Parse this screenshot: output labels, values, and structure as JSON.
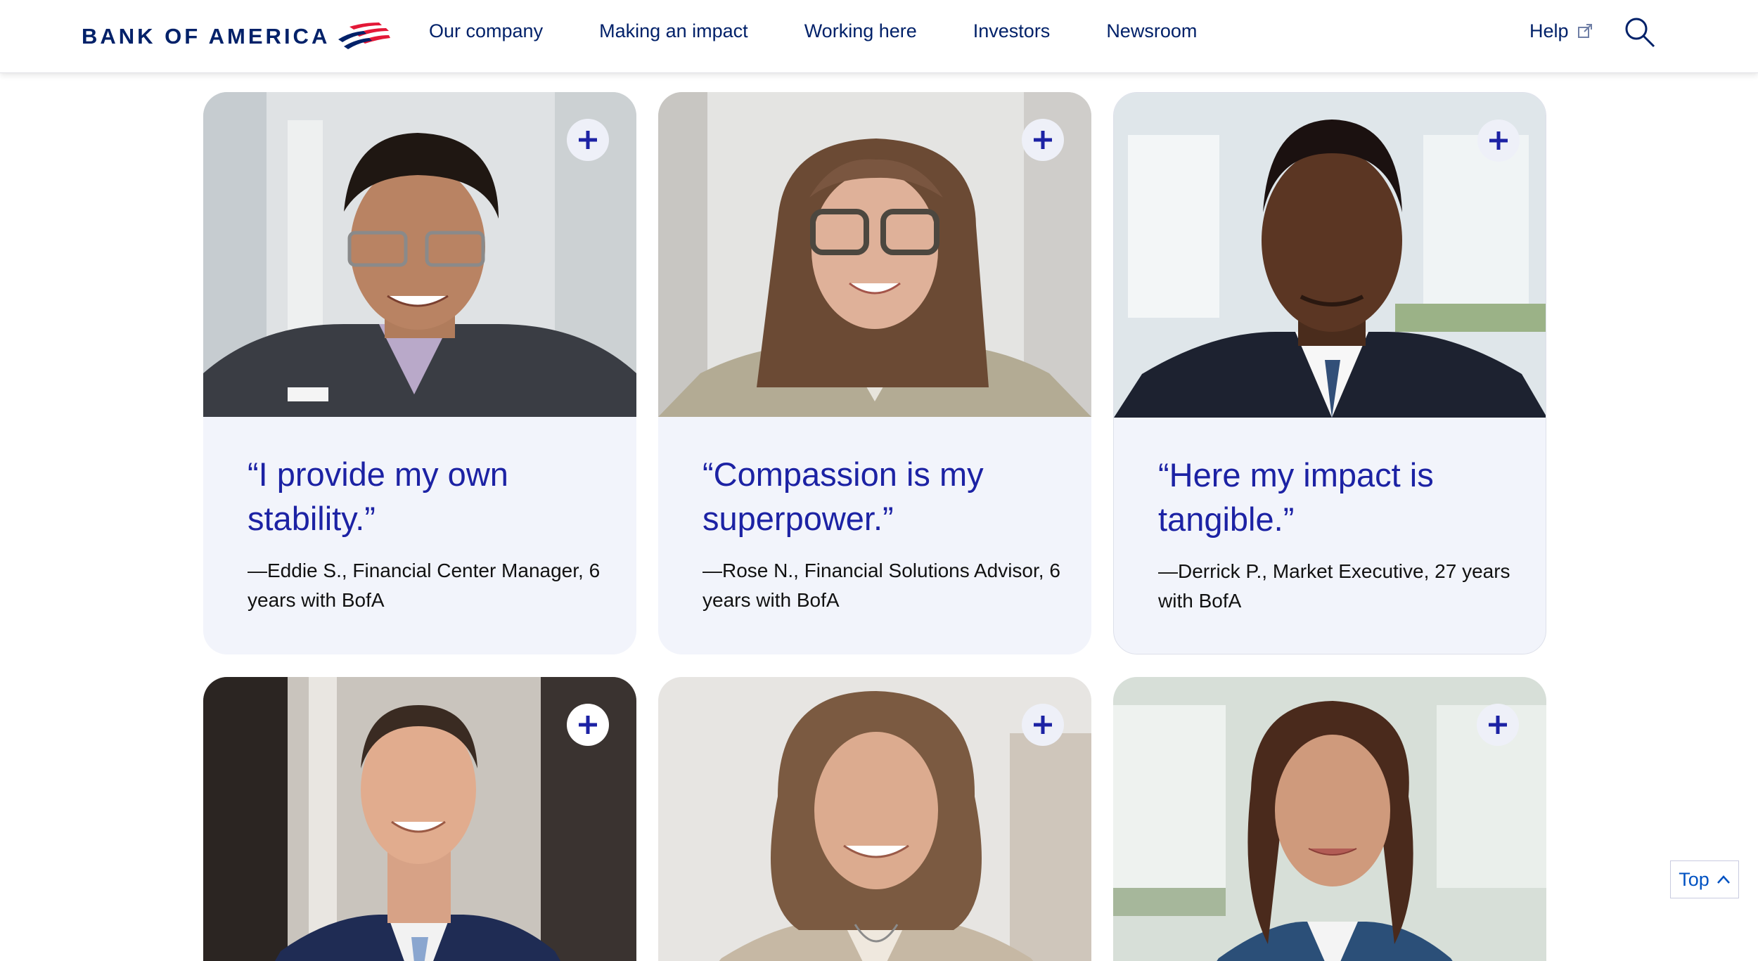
{
  "brand": {
    "name": "BANK OF AMERICA",
    "red": "#e31837",
    "navy": "#012169",
    "quote_blue": "#1c22a4"
  },
  "nav": {
    "items": [
      "Our company",
      "Making an impact",
      "Working here",
      "Investors",
      "Newsroom"
    ],
    "help_label": "Help",
    "search_icon": "magnifier-icon",
    "external_icon": "external-link-icon"
  },
  "cards": [
    {
      "quote": "“I provide my own stability.”",
      "attribution": "—Eddie S., Financial Center Manager, 6 years with BofA",
      "photo": "portrait-eddie"
    },
    {
      "quote": "“Compassion is my superpower.”",
      "attribution": "—Rose N., Financial Solutions Advisor, 6 years with BofA",
      "photo": "portrait-rose"
    },
    {
      "quote": "“Here my impact is tangible.”",
      "attribution": "—Derrick P., Market Executive, 27 years with BofA",
      "photo": "portrait-derrick"
    },
    {
      "photo": "portrait-man-navy-suit"
    },
    {
      "photo": "portrait-woman-curly-hair"
    },
    {
      "photo": "portrait-woman-blue-blazer"
    }
  ],
  "top_button": {
    "label": "Top",
    "icon": "chevron-up-icon"
  }
}
